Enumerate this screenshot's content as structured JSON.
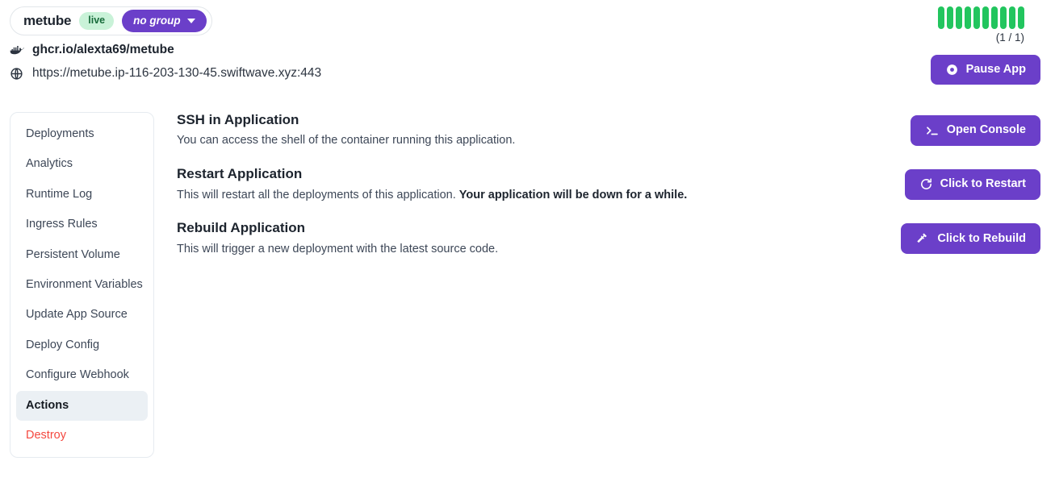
{
  "header": {
    "app_name": "metube",
    "status_badge": "live",
    "group_badge": "no group",
    "group_caret_icon": "chevron-down-icon",
    "docker_icon": "docker-whale-icon",
    "image": "ghcr.io/alexta69/metube",
    "globe_icon": "globe-icon",
    "url": "https://metube.ip-116-203-130-45.swiftwave.xyz:443",
    "replica_count": "(1 / 1)",
    "replica_bars": 10,
    "replica_bar_color": "#22c55e",
    "pause_button": {
      "label": "Pause App",
      "icon": "pause-circle-icon"
    }
  },
  "sidebar": {
    "items": [
      {
        "label": "Deployments",
        "active": false,
        "danger": false
      },
      {
        "label": "Analytics",
        "active": false,
        "danger": false
      },
      {
        "label": "Runtime Log",
        "active": false,
        "danger": false
      },
      {
        "label": "Ingress Rules",
        "active": false,
        "danger": false
      },
      {
        "label": "Persistent Volume",
        "active": false,
        "danger": false
      },
      {
        "label": "Environment Variables",
        "active": false,
        "danger": false
      },
      {
        "label": "Update App Source",
        "active": false,
        "danger": false
      },
      {
        "label": "Deploy Config",
        "active": false,
        "danger": false
      },
      {
        "label": "Configure Webhook",
        "active": false,
        "danger": false
      },
      {
        "label": "Actions",
        "active": true,
        "danger": false
      },
      {
        "label": "Destroy",
        "active": false,
        "danger": true
      }
    ]
  },
  "main": {
    "actions": [
      {
        "title": "SSH in Application",
        "description": "You can access the shell of the container running this application.",
        "description_bold": "",
        "button_label": "Open Console",
        "button_icon": "terminal-icon"
      },
      {
        "title": "Restart Application",
        "description": "This will restart all the deployments of this application. ",
        "description_bold": "Your application will be down for a while.",
        "button_label": "Click to Restart",
        "button_icon": "refresh-icon"
      },
      {
        "title": "Rebuild Application",
        "description": "This will trigger a new deployment with the latest source code.",
        "description_bold": "",
        "button_label": "Click to Rebuild",
        "button_icon": "hammer-icon"
      }
    ]
  },
  "colors": {
    "accent_purple": "#6b3fc9",
    "status_green": "#22c55e",
    "live_badge_bg": "#c9f2d8",
    "live_badge_text": "#176b3a",
    "danger_red": "#f4483f",
    "active_item_bg": "#ebf0f4"
  }
}
